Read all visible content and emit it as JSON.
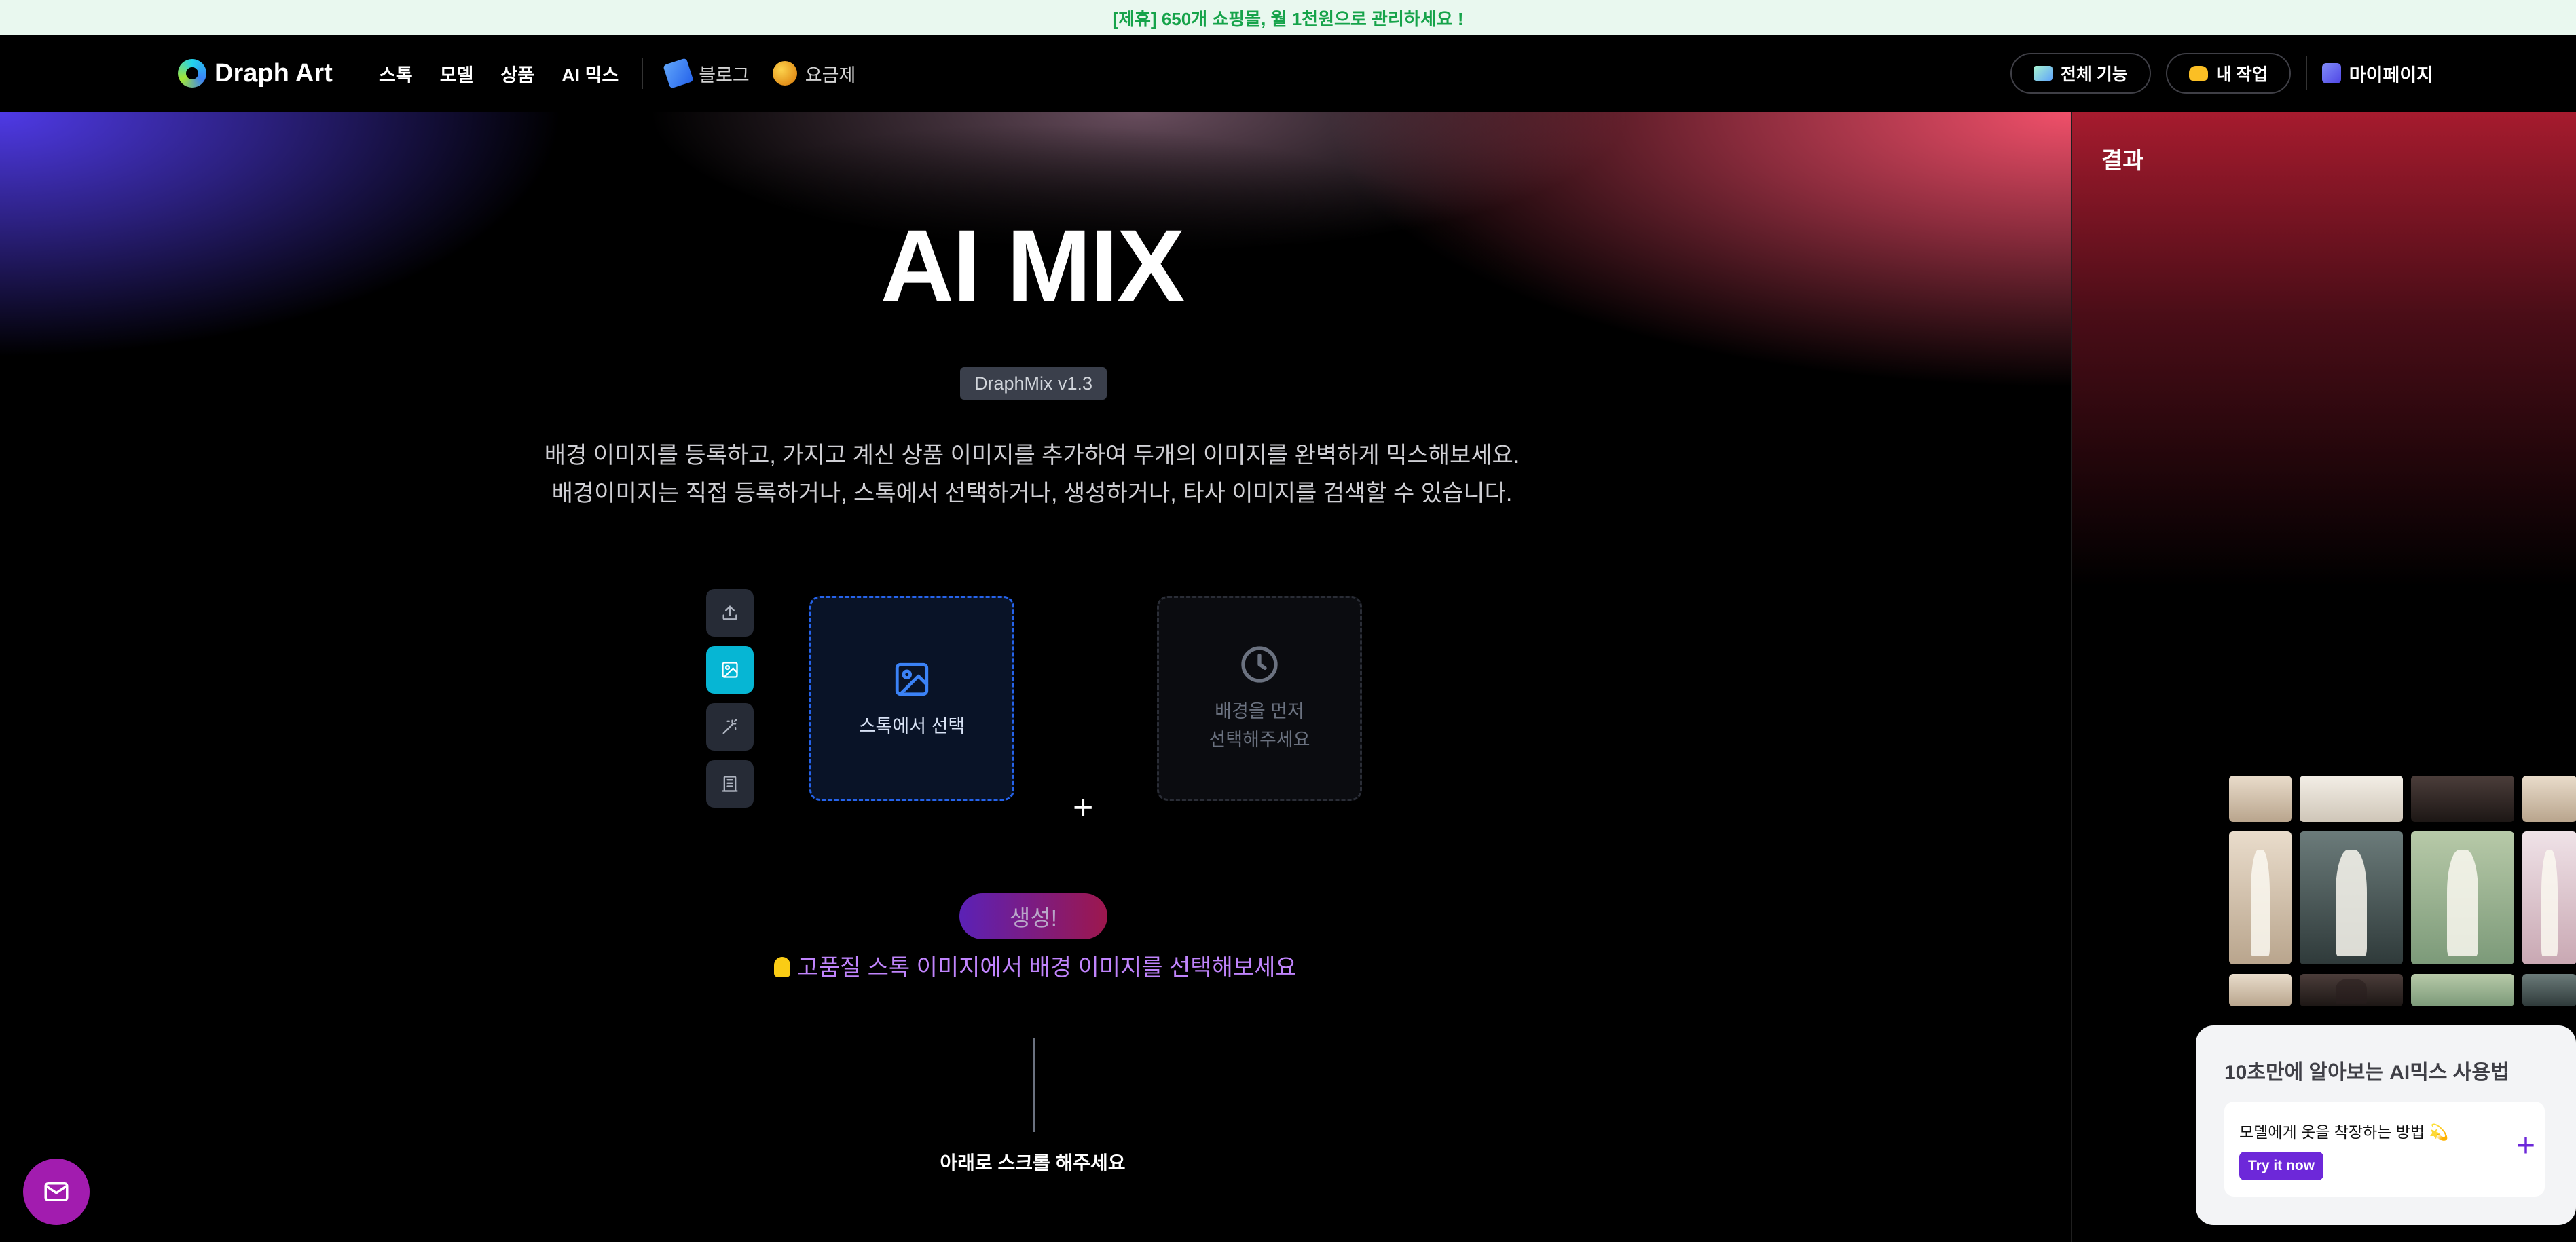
{
  "promo": {
    "text": "[제휴] 650개 쇼핑몰, 월 1천원으로 관리하세요 !"
  },
  "header": {
    "logo": "Draph Art",
    "nav": [
      "스톡",
      "모델",
      "상품",
      "AI 믹스"
    ],
    "blog": "블로그",
    "pricing": "요금제",
    "all_features": "전체 기능",
    "my_work": "내 작업",
    "mypage": "마이페이지"
  },
  "hero": {
    "title": "AI MIX",
    "version": "DraphMix v1.3",
    "desc1": "배경 이미지를 등록하고, 가지고 계신 상품 이미지를 추가하여 두개의 이미지를 완벽하게 믹스해보세요.",
    "desc2": "배경이미지는 직접 등록하거나, 스톡에서 선택하거나, 생성하거나, 타사 이미지를 검색할 수 있습니다."
  },
  "tools": [
    "upload-icon",
    "image-icon",
    "magic-wand-icon",
    "building-icon"
  ],
  "cards": {
    "stock_label": "스톡에서 선택",
    "pending_line1": "배경을 먼저",
    "pending_line2": "선택해주세요",
    "plus": "+"
  },
  "generate": {
    "label": "생성!"
  },
  "tip": {
    "text": "고품질 스톡 이미지에서 배경 이미지를 선택해보세요"
  },
  "scroll": {
    "hint": "아래로 스크롤 해주세요"
  },
  "result": {
    "title": "결과"
  },
  "tutorial": {
    "title": "10초만에 알아보는 AI믹스 사용법",
    "item": "모델에게 옷을 착장하는 방법 💫",
    "button": "Try it now",
    "plus": "+"
  },
  "colors": {
    "promo_bg": "#e9f8ef",
    "promo_text": "#16a34a",
    "active_tool": "#06b6d4",
    "stock_card_border": "#2563eb",
    "tip": "#c084fc",
    "mail_button": "#a21caf",
    "tutorial_button": "#6d28d9"
  }
}
